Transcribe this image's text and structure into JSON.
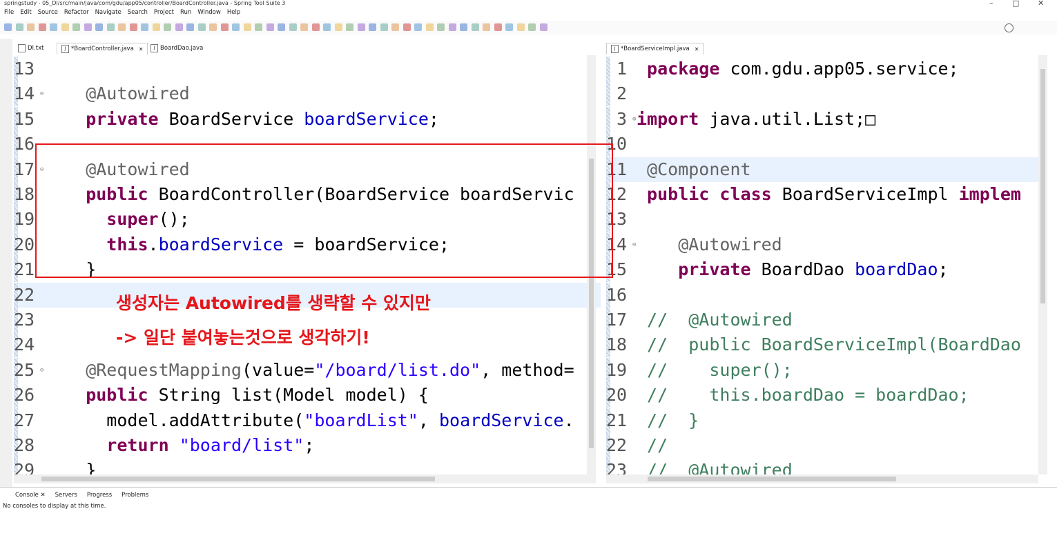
{
  "window": {
    "title": "springstudy - 05_DI/src/main/java/com/gdu/app05/controller/BoardController.java - Spring Tool Suite 3",
    "controls": [
      "–",
      "□",
      "✕"
    ]
  },
  "menu": [
    "File",
    "Edit",
    "Source",
    "Refactor",
    "Navigate",
    "Search",
    "Project",
    "Run",
    "Window",
    "Help"
  ],
  "left_editor": {
    "tabs": [
      {
        "label": "DI.txt",
        "active": false
      },
      {
        "label": "*BoardController.java",
        "active": true,
        "close": "✕"
      },
      {
        "label": "BoardDao.java",
        "active": false
      }
    ],
    "lines": [
      {
        "num": "13",
        "tokens": []
      },
      {
        "num": "14",
        "fold": "⊖",
        "tokens": [
          {
            "c": "ann",
            "t": "    @Autowired"
          }
        ]
      },
      {
        "num": "15",
        "tokens": [
          {
            "c": "kw",
            "t": "    private"
          },
          {
            "c": "",
            "t": " BoardService "
          },
          {
            "c": "fld",
            "t": "boardService"
          },
          {
            "c": "",
            "t": ";"
          }
        ]
      },
      {
        "num": "16",
        "tokens": []
      },
      {
        "num": "17",
        "fold": "⊖",
        "tokens": [
          {
            "c": "ann",
            "t": "    @Autowired"
          }
        ]
      },
      {
        "num": "18",
        "tokens": [
          {
            "c": "kw",
            "t": "    public"
          },
          {
            "c": "",
            "t": " BoardController(BoardService boardServic"
          }
        ]
      },
      {
        "num": "19",
        "tokens": [
          {
            "c": "kw",
            "t": "      super"
          },
          {
            "c": "",
            "t": "();"
          }
        ]
      },
      {
        "num": "20",
        "tokens": [
          {
            "c": "kw",
            "t": "      this"
          },
          {
            "c": "",
            "t": "."
          },
          {
            "c": "fld",
            "t": "boardService"
          },
          {
            "c": "",
            "t": " = boardService;"
          }
        ]
      },
      {
        "num": "21",
        "tokens": [
          {
            "c": "",
            "t": "    }"
          }
        ]
      },
      {
        "num": "22",
        "tokens": [],
        "current": true
      },
      {
        "num": "23",
        "tokens": []
      },
      {
        "num": "24",
        "tokens": []
      },
      {
        "num": "25",
        "fold": "⊖",
        "tokens": [
          {
            "c": "ann",
            "t": "    @RequestMapping"
          },
          {
            "c": "",
            "t": "(value="
          },
          {
            "c": "str",
            "t": "\"/board/list.do\""
          },
          {
            "c": "",
            "t": ", method="
          }
        ]
      },
      {
        "num": "26",
        "tokens": [
          {
            "c": "kw",
            "t": "    public"
          },
          {
            "c": "",
            "t": " String list(Model model) {"
          }
        ]
      },
      {
        "num": "27",
        "tokens": [
          {
            "c": "",
            "t": "      model.addAttribute("
          },
          {
            "c": "str",
            "t": "\"boardList\""
          },
          {
            "c": "",
            "t": ", "
          },
          {
            "c": "fld",
            "t": "boardService"
          },
          {
            "c": "",
            "t": "."
          }
        ]
      },
      {
        "num": "28",
        "tokens": [
          {
            "c": "kw",
            "t": "      return"
          },
          {
            "c": "",
            "t": " "
          },
          {
            "c": "str",
            "t": "\"board/list\""
          },
          {
            "c": "",
            "t": ";"
          }
        ]
      },
      {
        "num": "29",
        "tokens": [
          {
            "c": "",
            "t": "    }"
          }
        ]
      }
    ],
    "note_line1": "생성자는 Autowired를 생략할 수 있지만",
    "note_line2": "-> 일단 붙여놓는것으로 생각하기!"
  },
  "right_editor": {
    "tabs": [
      {
        "label": "*BoardServiceImpl.java",
        "active": true,
        "close": "✕"
      }
    ],
    "lines": [
      {
        "num": " 1",
        "tokens": [
          {
            "c": "kw",
            "t": " package"
          },
          {
            "c": "",
            "t": " com.gdu.app05.service;"
          }
        ]
      },
      {
        "num": " 2",
        "tokens": []
      },
      {
        "num": " 3",
        "fold": "⊕",
        "tokens": [
          {
            "c": "kw",
            "t": "import"
          },
          {
            "c": "",
            "t": " java.util.List;□"
          }
        ]
      },
      {
        "num": "10",
        "tokens": []
      },
      {
        "num": "11",
        "tokens": [
          {
            "c": "ann",
            "t": " @Component"
          }
        ],
        "current": true
      },
      {
        "num": "12",
        "tokens": [
          {
            "c": "kw",
            "t": " public class"
          },
          {
            "c": "",
            "t": " BoardServiceImpl "
          },
          {
            "c": "kw",
            "t": "implem"
          }
        ]
      },
      {
        "num": "13",
        "tokens": []
      },
      {
        "num": "14",
        "fold": "⊖",
        "tokens": [
          {
            "c": "ann",
            "t": "    @Autowired"
          }
        ]
      },
      {
        "num": "15",
        "tokens": [
          {
            "c": "kw",
            "t": "    private"
          },
          {
            "c": "",
            "t": " BoardDao "
          },
          {
            "c": "fld",
            "t": "boardDao"
          },
          {
            "c": "",
            "t": ";"
          }
        ]
      },
      {
        "num": "16",
        "tokens": []
      },
      {
        "num": "17",
        "tokens": [
          {
            "c": "cmt",
            "t": " //  @Autowired"
          }
        ]
      },
      {
        "num": "18",
        "tokens": [
          {
            "c": "cmt",
            "t": " //  public BoardServiceImpl(BoardDao"
          }
        ]
      },
      {
        "num": "19",
        "tokens": [
          {
            "c": "cmt",
            "t": " //    super();"
          }
        ]
      },
      {
        "num": "20",
        "tokens": [
          {
            "c": "cmt",
            "t": " //    this.boardDao = boardDao;"
          }
        ]
      },
      {
        "num": "21",
        "tokens": [
          {
            "c": "cmt",
            "t": " //  }"
          }
        ]
      },
      {
        "num": "22",
        "tokens": [
          {
            "c": "cmt",
            "t": " //"
          }
        ]
      },
      {
        "num": "23",
        "tokens": [
          {
            "c": "cmt",
            "t": " //  @Autowired"
          }
        ]
      }
    ]
  },
  "bottom_panel": {
    "tabs": [
      "Console",
      "Servers",
      "Progress",
      "Problems"
    ],
    "console_close": "✕",
    "message": "No consoles to display at this time."
  },
  "colors": {
    "keyword": "#7f0055",
    "annotation": "#646464",
    "string": "#2a00ff",
    "field": "#0000c0",
    "comment": "#3f7f5f",
    "highlight_box": "#e5161b"
  }
}
